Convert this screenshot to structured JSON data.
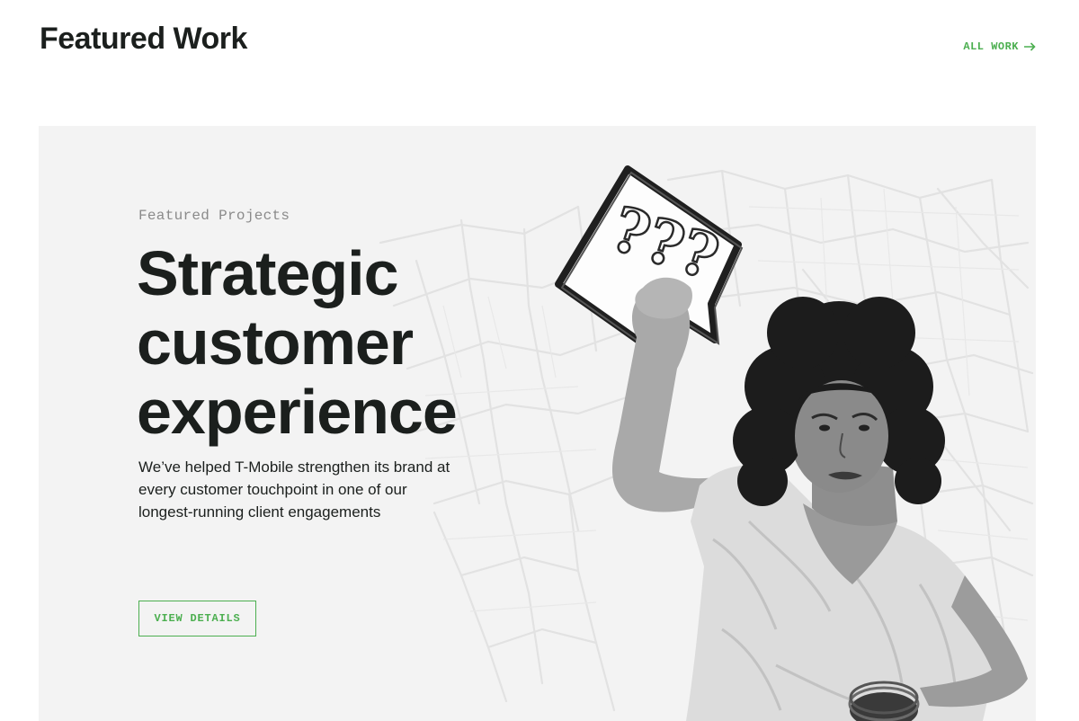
{
  "header": {
    "title": "Featured Work",
    "all_work_label": "ALL WORK",
    "all_work_icon": "arrow-right-icon"
  },
  "feature": {
    "eyebrow": "Featured Projects",
    "headline": "Strategic customer experience",
    "description": "We’ve helped T-Mobile strengthen its brand at every customer touchpoint in one of our longest-running client engagements",
    "button_label": "VIEW DETAILS",
    "sign_text": "???"
  },
  "colors": {
    "accent": "#4caf50",
    "text": "#1b1f1d",
    "card_background": "#f3f3f3",
    "eyebrow": "#8a8a8a"
  }
}
